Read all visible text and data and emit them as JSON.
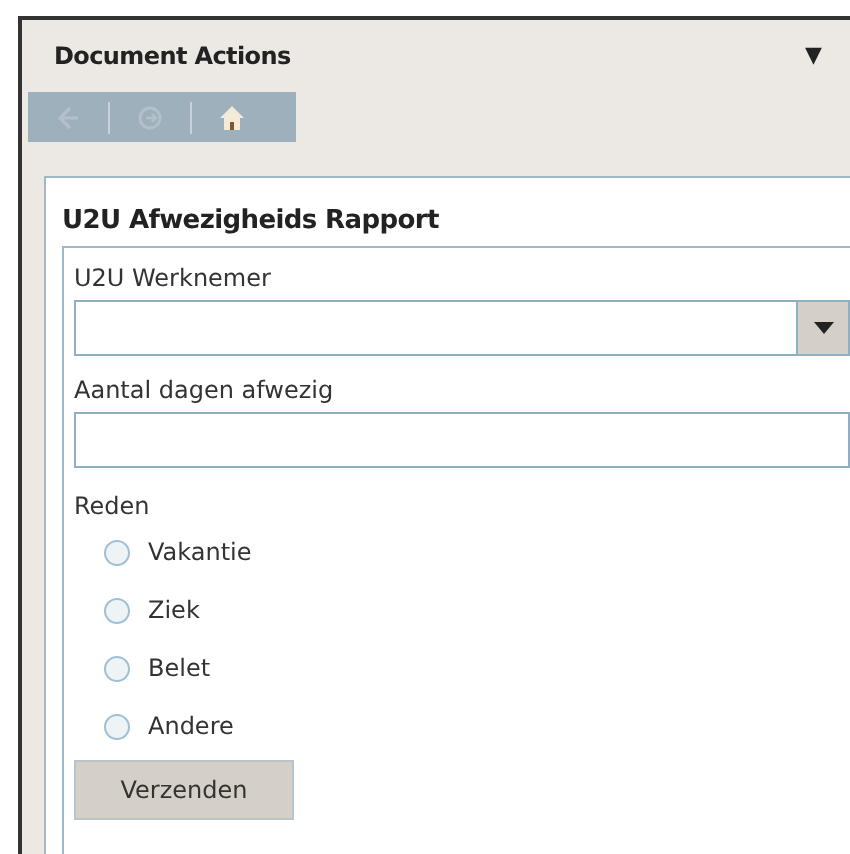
{
  "pane": {
    "title": "Document Actions",
    "menu_glyph": "▼"
  },
  "toolbar": [
    {
      "kind": "back",
      "disabled": true
    },
    {
      "kind": "forward",
      "disabled": true
    },
    {
      "kind": "home",
      "disabled": false
    }
  ],
  "form": {
    "title": "U2U Afwezigheids Rapport",
    "employee": {
      "label": "U2U Werknemer"
    },
    "days": {
      "label": "Aantal dagen afwezig"
    },
    "reason": {
      "label": "Reden",
      "options": [
        {
          "label": "Vakantie",
          "selected": false
        },
        {
          "label": "Ziek",
          "selected": false
        },
        {
          "label": "Belet",
          "selected": false
        },
        {
          "label": "Andere",
          "selected": false
        }
      ]
    },
    "submit": "Verzenden"
  }
}
